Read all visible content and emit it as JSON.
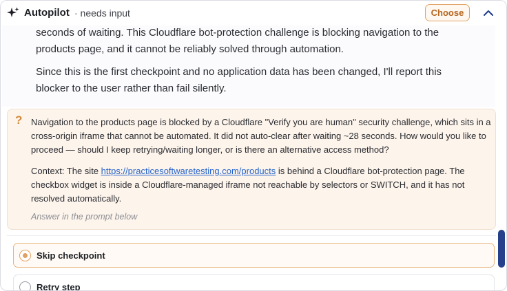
{
  "header": {
    "title": "Autopilot",
    "status": "· needs input",
    "choose_label": "Choose",
    "icons": {
      "brand": "sparkle-icon",
      "collapse": "chevron-up-icon"
    },
    "accent_color": "#e0a264"
  },
  "agent_message": {
    "paragraph_1": "seconds of waiting. This Cloudflare bot-protection challenge is blocking navigation to the products page, and it cannot be reliably solved through automation.",
    "paragraph_2": "Since this is the first checkpoint and no application data has been changed, I'll report this blocker to the user rather than fail silently."
  },
  "question": {
    "icon": "question-mark-icon",
    "text": "Navigation to the products page is blocked by a Cloudflare \"Verify you are human\" security challenge, which sits in a cross-origin iframe that cannot be automated. It did not auto-clear after waiting ~28 seconds. How would you like to proceed — should I keep retrying/waiting longer, or is there an alternative access method?",
    "context_prefix": "Context: The site ",
    "context_link": "https://practicesoftwaretesting.com/products",
    "context_suffix": " is behind a Cloudflare bot-protection page. The checkbox widget is inside a Cloudflare-managed iframe not reachable by selectors or SWITCH, and it has not resolved automatically.",
    "hint": "Answer in the prompt below"
  },
  "options": [
    {
      "label": "Skip checkpoint",
      "selected": true
    },
    {
      "label": "Retry step",
      "selected": false
    }
  ],
  "scrollbar_color": "#26408b"
}
